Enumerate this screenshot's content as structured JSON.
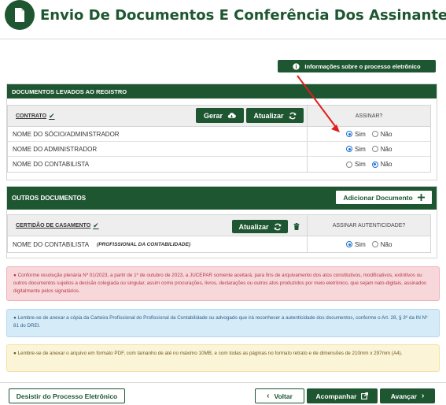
{
  "header": {
    "title": "Envio De Documentos E Conferência Dos Assinantes",
    "logo_icon": "document-icon"
  },
  "info_button": {
    "label": "Informações sobre o processo eletrônico",
    "icon": "info-circle-icon"
  },
  "registro": {
    "section_title": "DOCUMENTOS LEVADOS AO REGISTRO",
    "column_label": "CONTRATO",
    "gerar_label": "Gerar",
    "atualizar_label": "Atualizar",
    "assinar_header": "ASSINAR?",
    "rows": [
      {
        "name": "NOME DO SÓCIO/ADMINISTRADOR",
        "sim": "Sim",
        "nao": "Não",
        "selected": "sim"
      },
      {
        "name": "NOME DO ADMINISTRADOR",
        "sim": "Sim",
        "nao": "Não",
        "selected": "sim"
      },
      {
        "name": "NOME DO CONTABILISTA",
        "sim": "Sim",
        "nao": "Não",
        "selected": "nao"
      }
    ]
  },
  "outros": {
    "section_title": "OUTROS DOCUMENTOS",
    "add_label": "Adicionar Documento",
    "column_label": "CERTIDÃO DE CASAMENTO",
    "atualizar_label": "Atualizar",
    "autenticidade_header": "ASSINAR AUTENTICIDADE?",
    "rows": [
      {
        "name": "NOME DO CONTABILISTA",
        "role": "(PROFISSIONAL DA CONTABILIDADE)",
        "sim": "Sim",
        "nao": "Não",
        "selected": "sim"
      }
    ]
  },
  "alerts": {
    "danger": "Conforme resolução plenária Nº 01/2023, a partir de 1º de outubro de 2023, a JUCEPAR somente aceitará, para fins de arquivamento dos atos constitutivos, modificativos, extintivos ou outros documentos sujeitos a decisão colegiada ou singular, assim como procurações, livros, declarações ou outros atos produzidos por meio eletrônico, que sejam nato-digitais, assinados digitalmente pelos signatários.",
    "info": "Lembre-se de anexar a cópia da Carteira Profissional do Profissional da Contabilidade ou advogado que irá reconhecer a autenticidade dos documentos, conforme o Art. 28, § 3º da IN Nº 81 do DREI.",
    "warn": "Lembre-se de anexar o arquivo em formato PDF, com tamanho de até no máximo 10MB, e com todas as páginas no formato retrato e de dimensões de 210mm x 297mm (A4)."
  },
  "footer": {
    "desistir_label": "Desistir do Processo Eletrônico",
    "voltar_label": "Voltar",
    "acompanhar_label": "Acompanhar",
    "avancar_label": "Avançar"
  },
  "colors": {
    "primary": "#1e5631",
    "annotation_arrow": "#e21b1b"
  }
}
